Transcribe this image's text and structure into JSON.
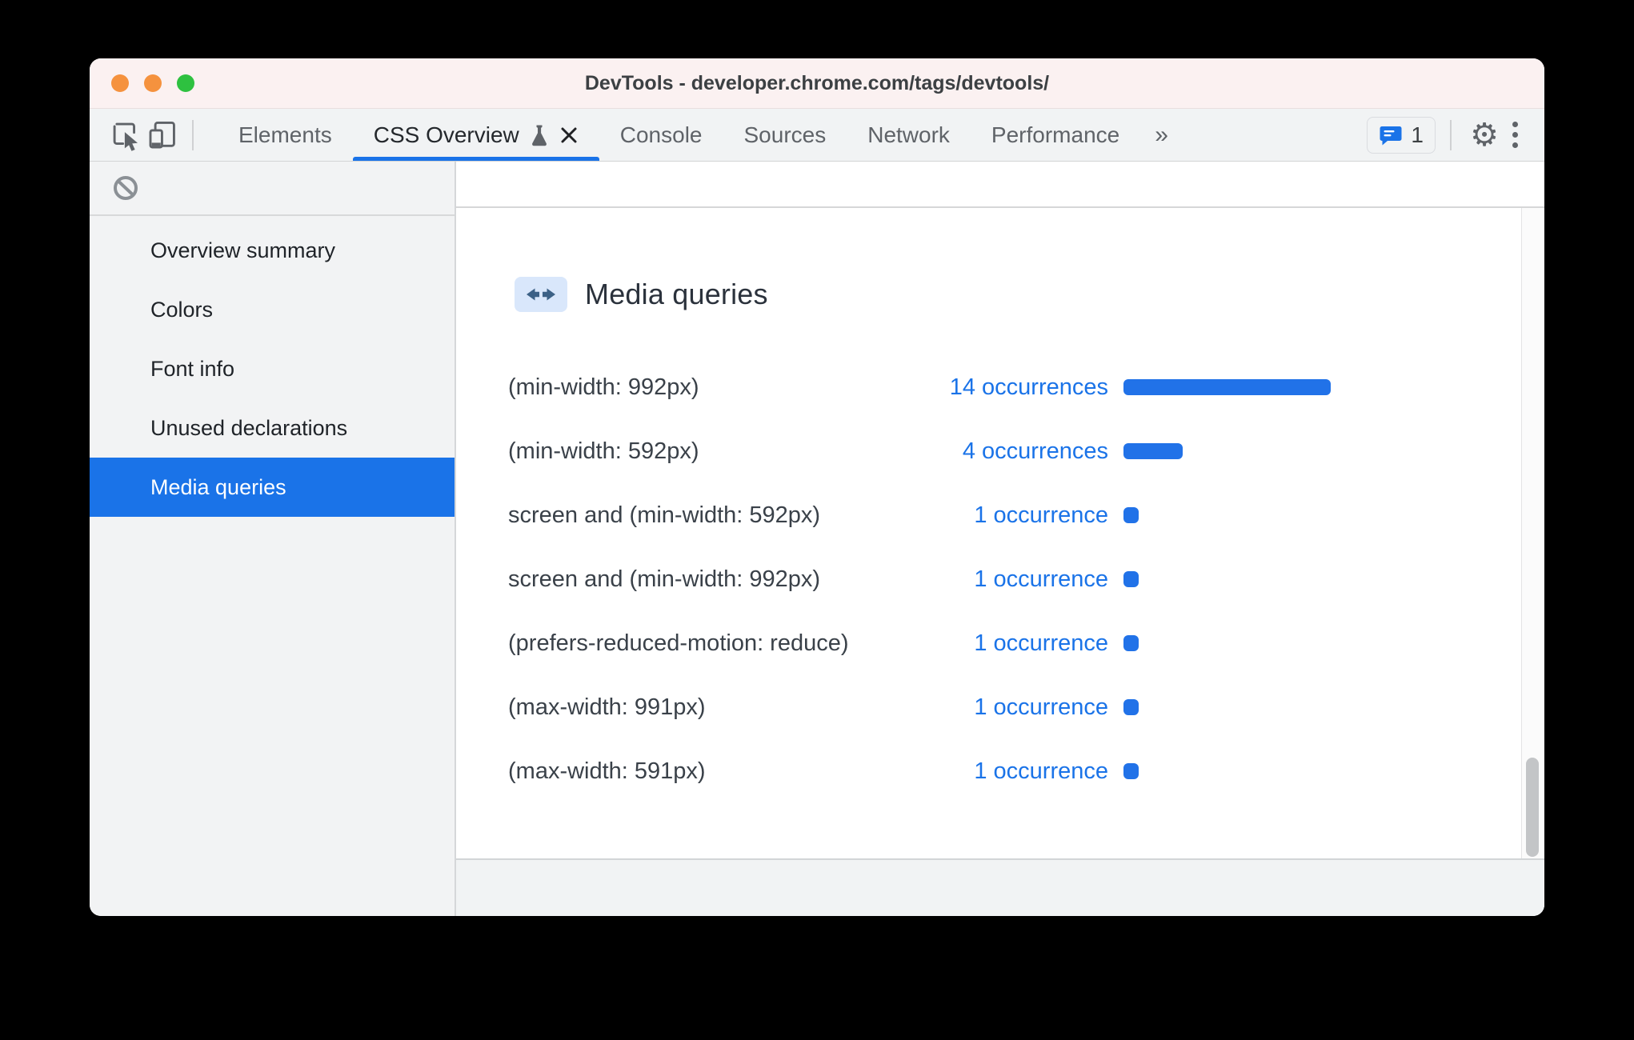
{
  "window": {
    "title": "DevTools - developer.chrome.com/tags/devtools/"
  },
  "titlebar_buttons": {
    "close_color": "#f5923e",
    "minimize_color": "#f5923e",
    "zoom_color": "#2ec140"
  },
  "toolbar": {
    "tabs": [
      {
        "label": "Elements",
        "active": false
      },
      {
        "label": "CSS Overview",
        "active": true
      },
      {
        "label": "Console",
        "active": false
      },
      {
        "label": "Sources",
        "active": false
      },
      {
        "label": "Network",
        "active": false
      },
      {
        "label": "Performance",
        "active": false
      }
    ],
    "overflow_label": "»",
    "feedback_count": "1"
  },
  "sidebar": {
    "items": [
      {
        "label": "Overview summary",
        "selected": false
      },
      {
        "label": "Colors",
        "selected": false
      },
      {
        "label": "Font info",
        "selected": false
      },
      {
        "label": "Unused declarations",
        "selected": false
      },
      {
        "label": "Media queries",
        "selected": true
      }
    ]
  },
  "main": {
    "heading": "Media queries",
    "rows": [
      {
        "query": "(min-width: 992px)",
        "occurrences": "14 occurrences",
        "count": 14
      },
      {
        "query": "(min-width: 592px)",
        "occurrences": "4 occurrences",
        "count": 4
      },
      {
        "query": "screen and (min-width: 592px)",
        "occurrences": "1 occurrence",
        "count": 1
      },
      {
        "query": "screen and (min-width: 992px)",
        "occurrences": "1 occurrence",
        "count": 1
      },
      {
        "query": "(prefers-reduced-motion: reduce)",
        "occurrences": "1 occurrence",
        "count": 1
      },
      {
        "query": "(max-width: 991px)",
        "occurrences": "1 occurrence",
        "count": 1
      },
      {
        "query": "(max-width: 591px)",
        "occurrences": "1 occurrence",
        "count": 1
      }
    ]
  },
  "colors": {
    "accent": "#1a73e8",
    "bar": "#2172e8",
    "pixels_per_occurrence": 18.5
  }
}
